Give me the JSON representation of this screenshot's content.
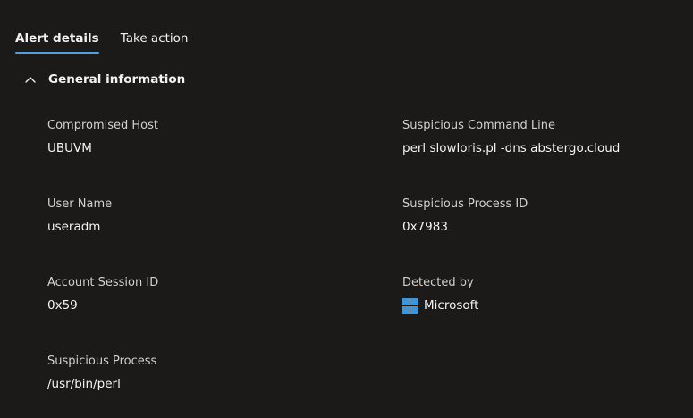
{
  "tabs": {
    "alert_details": "Alert details",
    "take_action": "Take action"
  },
  "section": {
    "title": "General information"
  },
  "fields": {
    "compromised_host": {
      "label": "Compromised Host",
      "value": "UBUVM"
    },
    "suspicious_command_line": {
      "label": "Suspicious Command Line",
      "value": "perl slowloris.pl -dns abstergo.cloud"
    },
    "user_name": {
      "label": "User Name",
      "value": "useradm"
    },
    "suspicious_process_id": {
      "label": "Suspicious Process ID",
      "value": "0x7983"
    },
    "account_session_id": {
      "label": "Account Session ID",
      "value": "0x59"
    },
    "detected_by": {
      "label": "Detected by",
      "value": "Microsoft",
      "icon": "windows-logo-icon"
    },
    "suspicious_process": {
      "label": "Suspicious Process",
      "value": "/usr/bin/perl"
    }
  },
  "colors": {
    "background": "#1b1a19",
    "accent": "#4f9ee0",
    "windows_logo": "#3a96dd"
  }
}
